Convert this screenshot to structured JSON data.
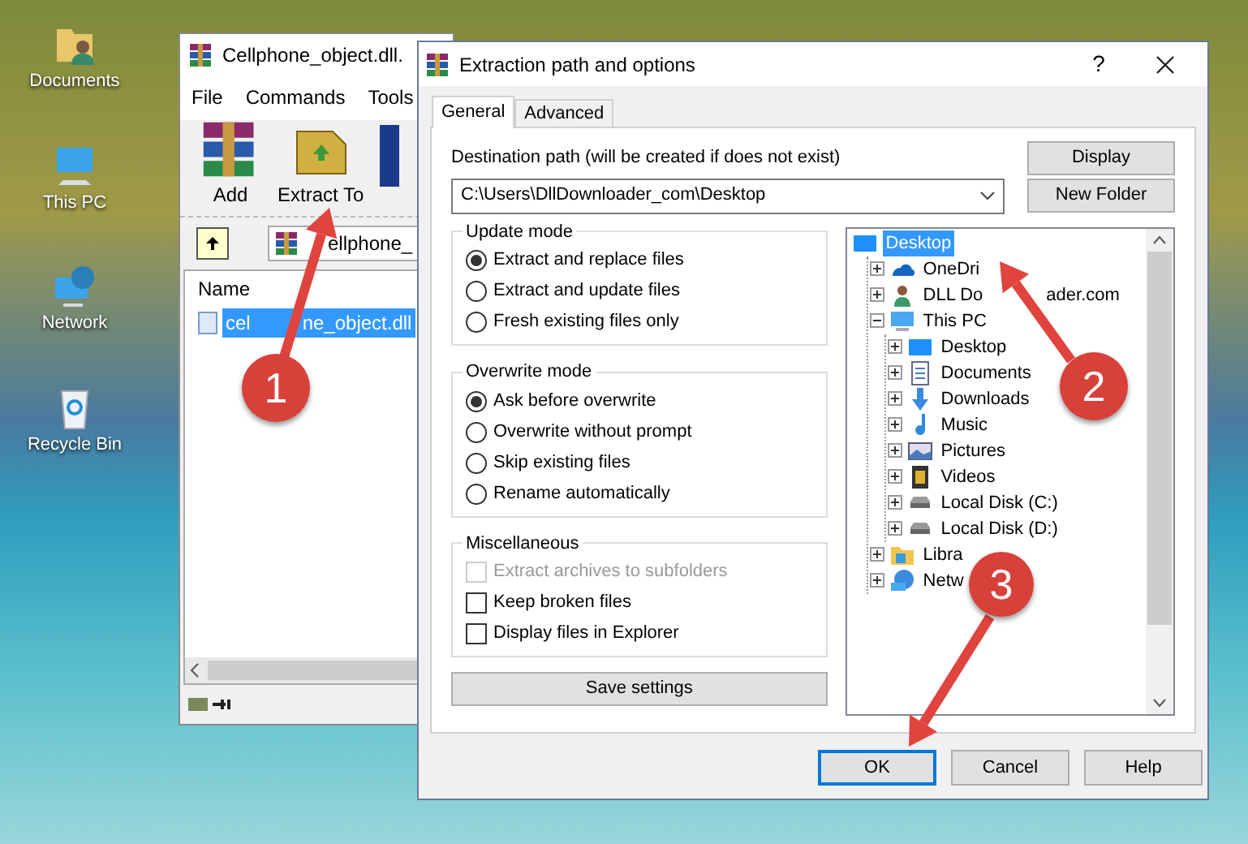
{
  "desktop_icons": [
    {
      "label": "Documents"
    },
    {
      "label": "This PC"
    },
    {
      "label": "Network"
    },
    {
      "label": "Recycle Bin"
    }
  ],
  "archiver_window": {
    "title": "Cellphone_object.dll.",
    "menu": [
      "File",
      "Commands",
      "Tools"
    ],
    "toolbar": [
      "Add",
      "Extract To"
    ],
    "path": "ellphone_",
    "column": "Name",
    "files": [
      {
        "name": "cel",
        "name_tail": "ne_object.dll",
        "selected": true
      }
    ]
  },
  "dialog": {
    "title": "Extraction path and options",
    "help": "?",
    "tabs": [
      {
        "label": "General",
        "selected": true
      },
      {
        "label": "Advanced",
        "selected": false
      }
    ],
    "destination_label": "Destination path (will be created if does not exist)",
    "destination_path": "C:\\Users\\DllDownloader_com\\Desktop",
    "side_buttons": [
      "Display",
      "New Folder"
    ],
    "groups": [
      {
        "title": "Update mode",
        "kind": "radio",
        "options": [
          {
            "label": "Extract and replace files",
            "selected": true
          },
          {
            "label": "Extract and update files",
            "selected": false
          },
          {
            "label": "Fresh existing files only",
            "selected": false
          }
        ]
      },
      {
        "title": "Overwrite mode",
        "kind": "radio",
        "options": [
          {
            "label": "Ask before overwrite",
            "selected": true
          },
          {
            "label": "Overwrite without prompt",
            "selected": false
          },
          {
            "label": "Skip existing files",
            "selected": false
          },
          {
            "label": "Rename automatically",
            "selected": false
          }
        ]
      },
      {
        "title": "Miscellaneous",
        "kind": "checkbox",
        "options": [
          {
            "label": "Extract archives to subfolders",
            "checked": false,
            "disabled": true
          },
          {
            "label": "Keep broken files",
            "checked": false,
            "disabled": false
          },
          {
            "label": "Display files in Explorer",
            "checked": false,
            "disabled": false
          }
        ]
      }
    ],
    "save_button": "Save settings",
    "tree": {
      "label": "Desktop",
      "selected": true,
      "children": [
        {
          "label": "OneDri",
          "selected": false,
          "expanded": false
        },
        {
          "label": "DLL Do",
          "label_tail": "ader.com",
          "selected": false,
          "expanded": false
        },
        {
          "label": "This PC",
          "selected": false,
          "expanded": true,
          "children": [
            {
              "label": "Desktop",
              "selected": false,
              "expanded": false
            },
            {
              "label": "Documents",
              "selected": false,
              "expanded": false
            },
            {
              "label": "Downloads",
              "selected": false,
              "expanded": false
            },
            {
              "label": "Music",
              "selected": false,
              "expanded": false
            },
            {
              "label": "Pictures",
              "selected": false,
              "expanded": false
            },
            {
              "label": "Videos",
              "selected": false,
              "expanded": false
            },
            {
              "label": "Local Disk (C:)",
              "selected": false,
              "expanded": false
            },
            {
              "label": "Local Disk (D:)",
              "selected": false,
              "expanded": false
            }
          ]
        },
        {
          "label": "Libra",
          "selected": false,
          "expanded": false
        },
        {
          "label": "Netw",
          "selected": false,
          "expanded": false
        }
      ]
    },
    "footer_buttons": [
      {
        "label": "OK",
        "focused": true
      },
      {
        "label": "Cancel",
        "focused": false
      },
      {
        "label": "Help",
        "focused": false
      }
    ]
  },
  "annotations": [
    {
      "label": "1"
    },
    {
      "label": "2"
    },
    {
      "label": "3"
    }
  ]
}
